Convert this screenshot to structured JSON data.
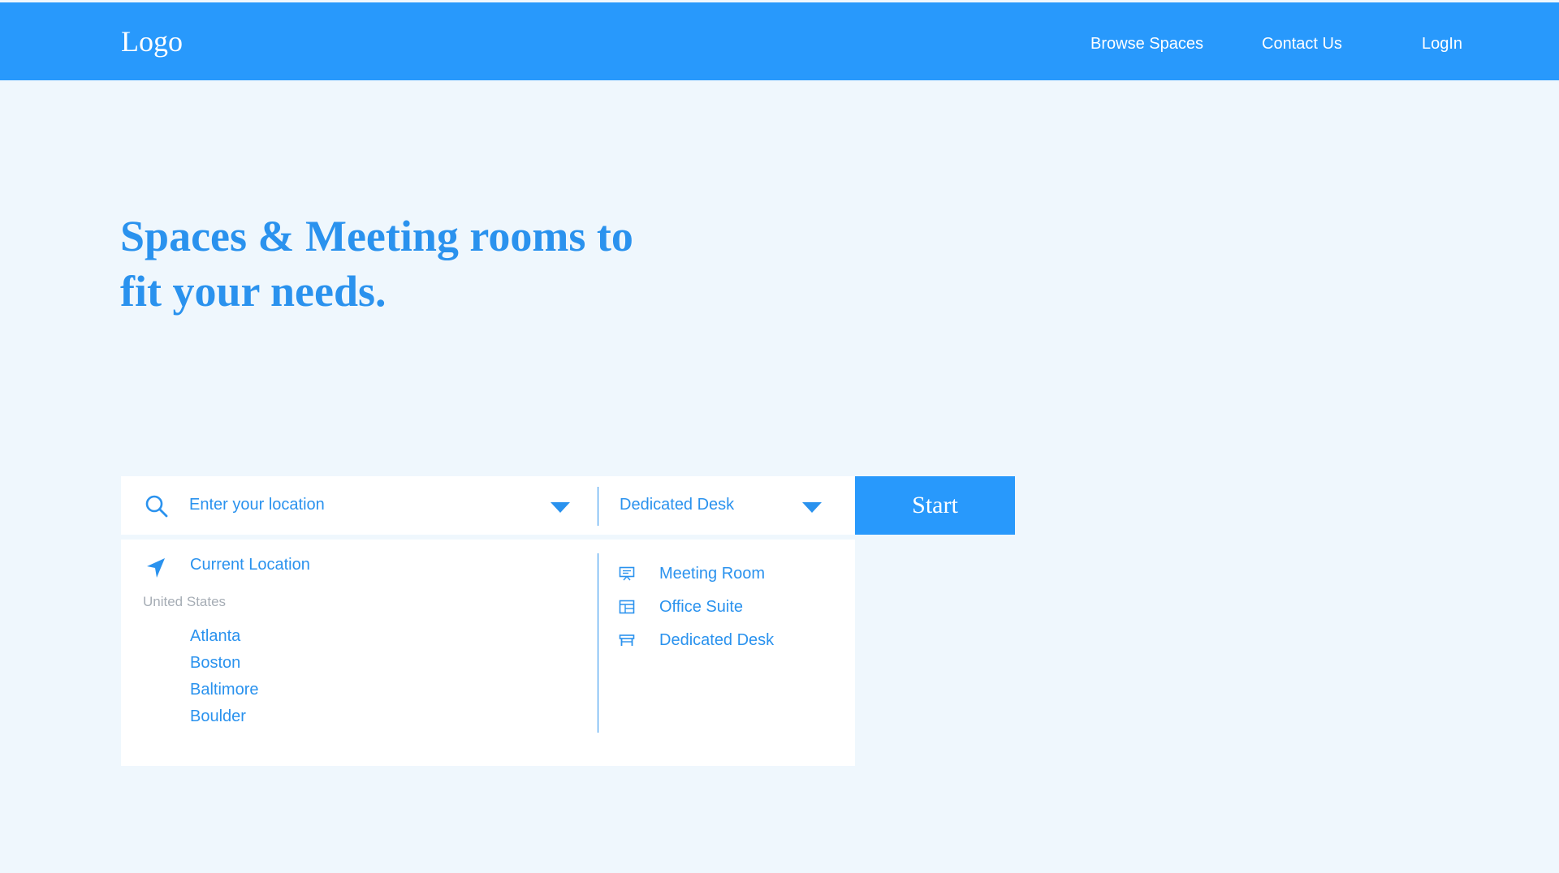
{
  "header": {
    "logo": "Logo",
    "nav": [
      "Browse Spaces",
      "Contact Us",
      "LogIn"
    ]
  },
  "hero": {
    "line1": "Spaces & Meeting rooms to",
    "line2": "fit your needs."
  },
  "search": {
    "location_placeholder": "Enter your location",
    "space_type_value": "Dedicated Desk",
    "start_label": "Start"
  },
  "location_dropdown": {
    "current_location": "Current Location",
    "group_label": "United States",
    "cities": [
      "Atlanta",
      "Boston",
      "Baltimore",
      "Boulder"
    ]
  },
  "type_dropdown": {
    "options": [
      {
        "label": "Meeting Room",
        "icon": "presentation-icon"
      },
      {
        "label": "Office Suite",
        "icon": "office-suite-icon"
      },
      {
        "label": "Dedicated Desk",
        "icon": "desk-icon"
      }
    ]
  },
  "colors": {
    "brand": "#2899fc",
    "text_accent": "#2a92ee",
    "background": "#eff7fd",
    "muted": "#a6adb5"
  }
}
